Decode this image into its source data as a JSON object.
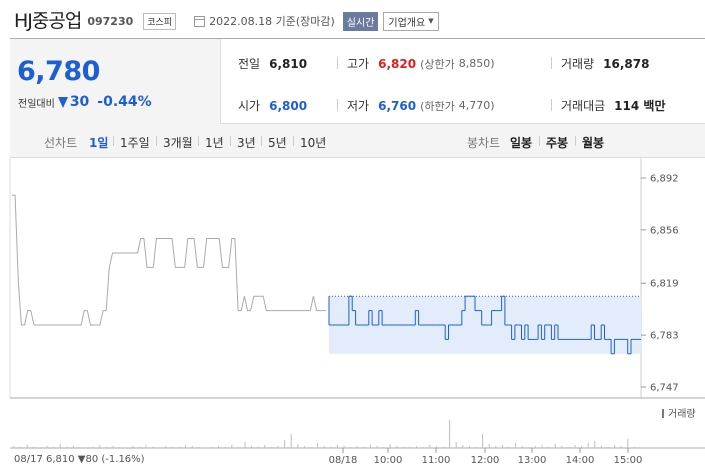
{
  "header": {
    "company": "HJ중공업",
    "code": "097230",
    "market": "코스피",
    "date": "2022.08.18 기준(장마감)",
    "realtime": "실시간",
    "corp_info": "기업개요"
  },
  "price": {
    "current": "6,780",
    "diff_label": "전일대비",
    "diff": "30",
    "diff_pct": "-0.44%"
  },
  "stats": {
    "prev_label": "전일",
    "prev": "6,810",
    "high_label": "고가",
    "high": "6,820",
    "upper_label": "(상한가",
    "upper": "8,850)",
    "volume_label": "거래량",
    "volume": "16,878",
    "open_label": "시가",
    "open": "6,800",
    "low_label": "저가",
    "low": "6,760",
    "lower_label": "(하한가",
    "lower": "4,770)",
    "amount_label": "거래대금",
    "amount": "114 백만"
  },
  "tabs": {
    "line_head": "선차트",
    "line": [
      "1일",
      "1주일",
      "3개월",
      "1년",
      "3년",
      "5년",
      "10년"
    ],
    "candle_head": "봉차트",
    "candle": [
      "일봉",
      "주봉",
      "월봉"
    ]
  },
  "chart_data": {
    "type": "line",
    "yticks": [
      "6,892",
      "6,856",
      "6,819",
      "6,783",
      "6,747"
    ],
    "ylim": [
      6747,
      6892
    ],
    "xticks": [
      "08/18",
      "10:00",
      "11:00",
      "12:00",
      "13:00",
      "14:00",
      "15:00"
    ],
    "volume_label": "거래량",
    "prev_footer": "08/17 6,810 ▼80 (-1.16%)",
    "prev_close": 6810,
    "series": [
      {
        "name": "",
        "values": [
          6810,
          6790,
          6790,
          6790,
          6790,
          6790,
          6790,
          6810,
          6800,
          6790,
          6790,
          6790,
          6790,
          6800,
          6790,
          6790,
          6800,
          6790,
          6790,
          6790,
          6790,
          6790,
          6790,
          6790,
          6790,
          6790,
          6790,
          6800,
          6790,
          6790,
          6790,
          6790,
          6790,
          6790,
          6790,
          6790,
          6780,
          6790,
          6790,
          6790,
          6790,
          6800,
          6810,
          6810,
          6810,
          6800,
          6800,
          6790,
          6790,
          6790,
          6800,
          6800,
          6800,
          6810,
          6790,
          6790,
          6780,
          6790,
          6790,
          6780,
          6790,
          6780,
          6780,
          6780,
          6790,
          6780,
          6790,
          6790,
          6780,
          6790,
          6780,
          6780,
          6780,
          6780,
          6780,
          6780,
          6780,
          6780,
          6780,
          6780,
          6790,
          6780,
          6780,
          6790,
          6780,
          6780,
          6770,
          6780,
          6780,
          6780,
          6780,
          6770,
          6780,
          6780,
          6780
        ]
      }
    ]
  }
}
